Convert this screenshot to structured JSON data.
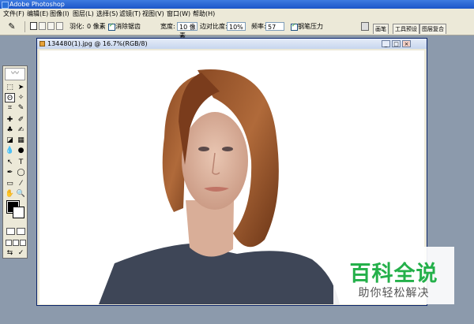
{
  "titlebar": {
    "title": "Adobe Photoshop"
  },
  "menu": [
    {
      "label": "文件(F)"
    },
    {
      "label": "编辑(E)"
    },
    {
      "label": "图像(I)"
    },
    {
      "label": "图层(L)"
    },
    {
      "label": "选择(S)"
    },
    {
      "label": "滤镜(T)"
    },
    {
      "label": "视图(V)"
    },
    {
      "label": "窗口(W)"
    },
    {
      "label": "帮助(H)"
    }
  ],
  "options": {
    "feather_label": "羽化:",
    "feather_value": "0 像素",
    "antialias_label": "消除锯齿",
    "width_label": "宽度:",
    "width_value": "10 像素",
    "edge_contrast_label": "边对比度:",
    "edge_contrast_value": "10%",
    "frequency_label": "频率:",
    "frequency_value": "57",
    "pen_pressure_label": "钢笔压力"
  },
  "palette_well": {
    "tabs": [
      "画笔",
      "工具预设",
      "图层复合"
    ]
  },
  "document": {
    "title": "134480(1).jpg @ 16.7%(RGB/8)",
    "buttons": {
      "minimize": "_",
      "maximize": "□",
      "close": "×"
    }
  },
  "toolbox": {
    "tools": [
      "marquee-tool-icon",
      "move-tool-icon",
      "lasso-tool-icon",
      "magic-wand-tool-icon",
      "crop-tool-icon",
      "slice-tool-icon",
      "healing-brush-icon",
      "brush-tool-icon",
      "clone-stamp-icon",
      "history-brush-icon",
      "eraser-icon",
      "gradient-icon",
      "blur-icon",
      "dodge-icon",
      "path-select-icon",
      "type-tool-icon",
      "pen-tool-icon",
      "shape-tool-icon",
      "notes-icon",
      "eyedropper-icon",
      "hand-tool-icon",
      "zoom-tool-icon"
    ],
    "colors": {
      "foreground": "#000000",
      "background": "#ffffff"
    }
  },
  "watermark": {
    "logo": "百科全说",
    "subtitle": "助你轻松解决"
  }
}
